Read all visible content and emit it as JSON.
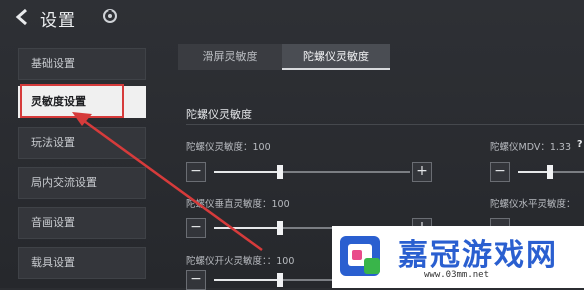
{
  "header": {
    "title": "设置"
  },
  "sidebar": {
    "items": [
      {
        "label": "基础设置"
      },
      {
        "label": "灵敏度设置"
      },
      {
        "label": "玩法设置"
      },
      {
        "label": "局内交流设置"
      },
      {
        "label": "音画设置"
      },
      {
        "label": "载具设置"
      }
    ]
  },
  "tabs": [
    {
      "label": "滑屏灵敏度"
    },
    {
      "label": "陀螺仪灵敏度"
    }
  ],
  "section_title": "陀螺仪灵敏度",
  "settings": {
    "gyro": {
      "label": "陀螺仪灵敏度：100",
      "level": 100
    },
    "gyro_mdv": {
      "label": "陀螺仪MDV：1.33",
      "help": "?"
    },
    "gyro_vertical": {
      "label": "陀螺仪垂直灵敏度：100"
    },
    "gyro_horizontal": {
      "label": "陀螺仪水平灵敏度："
    },
    "gyro_fire": {
      "label": "陀螺仪开火灵敏度：：100"
    }
  },
  "buttons": {
    "minus": "−",
    "plus": "+"
  },
  "watermark": {
    "text": "嘉冠游戏网",
    "url": "www.03mm.net"
  },
  "colors": {
    "annotation": "#d63b3b",
    "active_bg": "#f0f0f0",
    "watermark_blue": "#2a5fd0"
  }
}
